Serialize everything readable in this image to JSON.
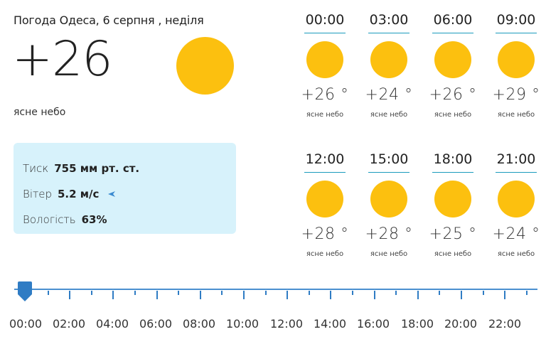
{
  "header": {
    "title": "Погода Одеса, 6 серпня , неділя"
  },
  "current": {
    "temperature": "+26",
    "description": "ясне небо",
    "icon": "sun-icon"
  },
  "details": {
    "pressure_label": "Тиск",
    "pressure_value": "755 мм рт. ст.",
    "wind_label": "Вітер",
    "wind_value": "5.2 м/с",
    "wind_icon": "wind-direction-arrow-icon",
    "humidity_label": "Вологість",
    "humidity_value": "63%"
  },
  "hourly": [
    {
      "time": "00:00",
      "temp": "+26 °",
      "desc": "ясне небо",
      "icon": "sun-icon"
    },
    {
      "time": "03:00",
      "temp": "+24 °",
      "desc": "ясне небо",
      "icon": "sun-icon"
    },
    {
      "time": "06:00",
      "temp": "+26 °",
      "desc": "ясне небо",
      "icon": "sun-icon"
    },
    {
      "time": "09:00",
      "temp": "+29 °",
      "desc": "ясне небо",
      "icon": "sun-icon"
    },
    {
      "time": "12:00",
      "temp": "+28 °",
      "desc": "ясне небо",
      "icon": "sun-icon"
    },
    {
      "time": "15:00",
      "temp": "+28 °",
      "desc": "ясне небо",
      "icon": "sun-icon"
    },
    {
      "time": "18:00",
      "temp": "+25 °",
      "desc": "ясне небо",
      "icon": "sun-icon"
    },
    {
      "time": "21:00",
      "temp": "+24 °",
      "desc": "ясне небо",
      "icon": "sun-icon"
    }
  ],
  "timeline": {
    "labels": [
      "00:00",
      "02:00",
      "04:00",
      "06:00",
      "08:00",
      "10:00",
      "12:00",
      "14:00",
      "16:00",
      "18:00",
      "20:00",
      "22:00"
    ],
    "selected": "00:00"
  },
  "colors": {
    "sun": "#fcc00f",
    "accent": "#2f7cc4",
    "panel": "#d7f2fb",
    "divider": "#1a9bbd"
  }
}
